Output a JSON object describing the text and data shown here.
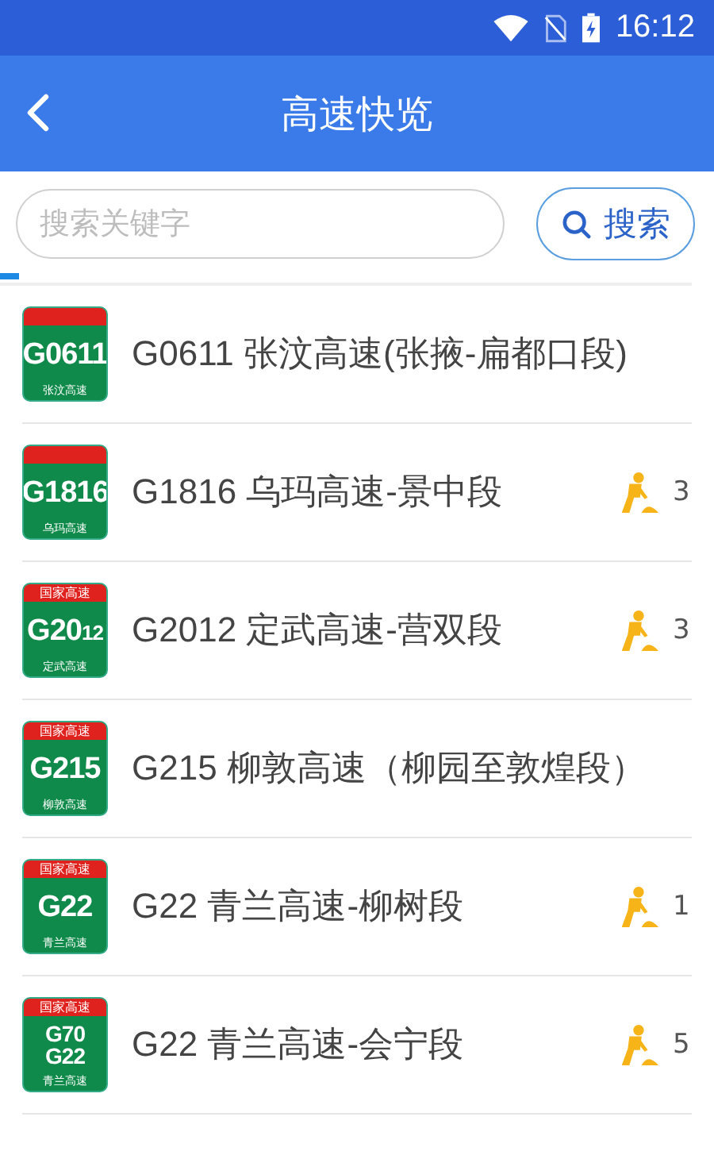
{
  "status_bar": {
    "time": "16:12"
  },
  "header": {
    "title": "高速快览"
  },
  "search": {
    "placeholder": "搜索关键字",
    "button": "搜索"
  },
  "roads": [
    {
      "shield": {
        "lines": [
          "G0611"
        ],
        "subtitle": "张汶高速"
      },
      "name": "G0611 张汶高速(张掖-扁都口段)"
    },
    {
      "shield": {
        "lines": [
          "G1816"
        ],
        "subtitle": "乌玛高速"
      },
      "name": "G1816 乌玛高速-景中段",
      "construction_count": "3"
    },
    {
      "shield": {
        "top": "国家高速",
        "lines": [
          "G20"
        ],
        "suffix": "12",
        "subtitle": "定武高速"
      },
      "name": "G2012 定武高速-营双段",
      "construction_count": "3"
    },
    {
      "shield": {
        "top": "国家高速",
        "lines": [
          "G215"
        ],
        "subtitle": "柳敦高速"
      },
      "name": "G215 柳敦高速（柳园至敦煌段）"
    },
    {
      "shield": {
        "top": "国家高速",
        "lines": [
          "G22"
        ],
        "subtitle": "青兰高速"
      },
      "name": "G22 青兰高速-柳树段",
      "construction_count": "1"
    },
    {
      "shield": {
        "top": "国家高速",
        "lines": [
          "G70",
          "G22"
        ],
        "subtitle": "青兰高速"
      },
      "name": "G22 青兰高速-会宁段",
      "construction_count": "5"
    }
  ]
}
